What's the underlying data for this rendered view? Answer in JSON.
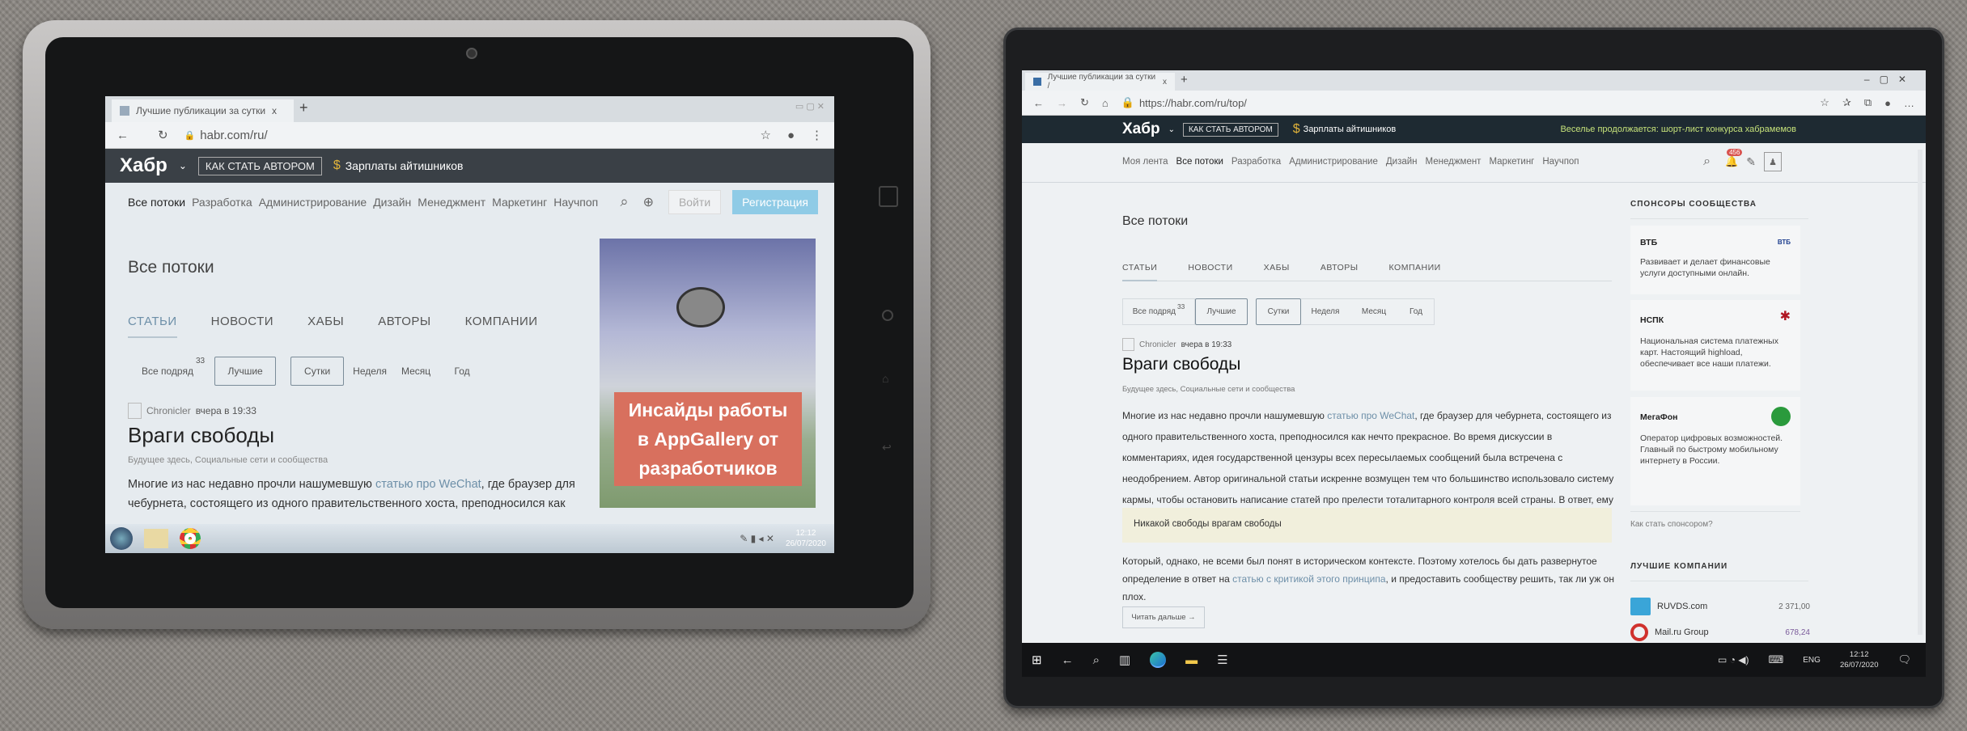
{
  "left_device": {
    "browser": {
      "tab_title": "Лучшие публикации за сутки",
      "tab_close": "x",
      "new_tab": "+",
      "url": "habr.com/ru/"
    },
    "header": {
      "logo": "Хабр",
      "become_author": "КАК СТАТЬ АВТОРОМ",
      "salaries": "Зарплаты айтишников"
    },
    "nav": {
      "items": [
        "Все потоки",
        "Разработка",
        "Администрирование",
        "Дизайн",
        "Менеджмент",
        "Маркетинг",
        "Научпоп"
      ],
      "login": "Войти",
      "register": "Регистрация"
    },
    "page_title": "Все потоки",
    "tabs": [
      "СТАТЬИ",
      "НОВОСТИ",
      "ХАБЫ",
      "АВТОРЫ",
      "КОМПАНИИ"
    ],
    "filters": {
      "all": "Все подряд",
      "all_count": "33",
      "best": "Лучшие",
      "periods": [
        "Сутки",
        "Неделя",
        "Месяц",
        "Год"
      ]
    },
    "post": {
      "author": "Chronicler",
      "time": "вчера в 19:33",
      "title": "Враги свободы",
      "hubs": "Будущее здесь, Социальные сети и сообщества",
      "body_a": "Многие из нас недавно прочли нашумевшую ",
      "body_link": "статью про WeChat",
      "body_b": ", где браузер для",
      "body_c": "чебурнета, состоящего из одного правительственного хоста, преподносился как"
    },
    "ad": {
      "text": "Инсайды работы в AppGallery от разработчиков"
    },
    "taskbar": {
      "time": "12:12",
      "date": "26/07/2020"
    }
  },
  "right_device": {
    "browser": {
      "tab_title": "Лучшие публикации за сутки /",
      "tab_close": "x",
      "new_tab": "+",
      "url": "https://habr.com/ru/top/"
    },
    "header": {
      "logo": "Хабр",
      "become_author": "КАК СТАТЬ АВТОРОМ",
      "salaries": "Зарплаты айтишников",
      "promo": "Веселье продолжается: шорт-лист конкурса хабрамемов"
    },
    "nav": {
      "items": [
        "Моя лента",
        "Все потоки",
        "Разработка",
        "Администрирование",
        "Дизайн",
        "Менеджмент",
        "Маркетинг",
        "Научпоп"
      ],
      "notifications": "456"
    },
    "page_title": "Все потоки",
    "tabs": [
      "СТАТЬИ",
      "НОВОСТИ",
      "ХАБЫ",
      "АВТОРЫ",
      "КОМПАНИИ"
    ],
    "filters": {
      "all": "Все подряд",
      "all_count": "33",
      "best": "Лучшие",
      "periods": [
        "Сутки",
        "Неделя",
        "Месяц",
        "Год"
      ]
    },
    "post": {
      "author": "Chronicler",
      "time": "вчера в 19:33",
      "title": "Враги свободы",
      "hubs": "Будущее здесь, Социальные сети и сообщества",
      "p1_a": "Многие из нас недавно прочли нашумевшую ",
      "p1_link": "статью про WeChat",
      "p1_b": ", где браузер для чебурнета, состоящего из одного правительственного хоста, преподносился как нечто прекрасное. Во время дискуссии в комментариях, идея государственной цензуры всех пересылаемых сообщений была встречена с неодобрением. Автор оригинальной статьи искренне возмущен тем что большинство использовало систему кармы, чтобы остановить написание статей про прелести тоталитарного контроля всей страны. В ответ, ему было предложено задуматься над принципом",
      "quote": "Никакой свободы врагам свободы",
      "p2_a": "Который, однако, не всеми был понят в историческом контексте. Поэтому хотелось бы дать развернутое определение в ответ на ",
      "p2_link": "статью с критикой этого принципа",
      "p2_b": ", и предоставить сообществу решить, так ли уж он плох.",
      "read_more": "Читать дальше →"
    },
    "sidebar": {
      "sponsors_title": "СПОНСОРЫ СООБЩЕСТВА",
      "sponsors": [
        {
          "name": "ВТБ",
          "logo": "ВТБ",
          "desc": "Развивает и делает финансовые услуги доступными онлайн."
        },
        {
          "name": "НСПК",
          "desc": "Национальная система платежных карт. Настоящий highload, обеспечивает все наши платежи."
        },
        {
          "name": "МегаФон",
          "desc": "Оператор цифровых возможностей. Главный по быстрому мобильному интернету в России."
        }
      ],
      "become_sponsor": "Как стать спонсором?",
      "companies_title": "ЛУЧШИЕ КОМПАНИИ",
      "companies": [
        {
          "name": "RUVDS.com",
          "rating": "2 371,00"
        },
        {
          "name": "Mail.ru Group",
          "rating": "678,24"
        }
      ]
    },
    "taskbar": {
      "lang": "ENG",
      "time": "12:12",
      "date": "26/07/2020"
    }
  },
  "colors": {
    "habr_header": "#303b44",
    "register": "#8fcbe6",
    "ad_red": "#d8705e",
    "badge": "#d9534f",
    "promo": "#c6e27a"
  }
}
